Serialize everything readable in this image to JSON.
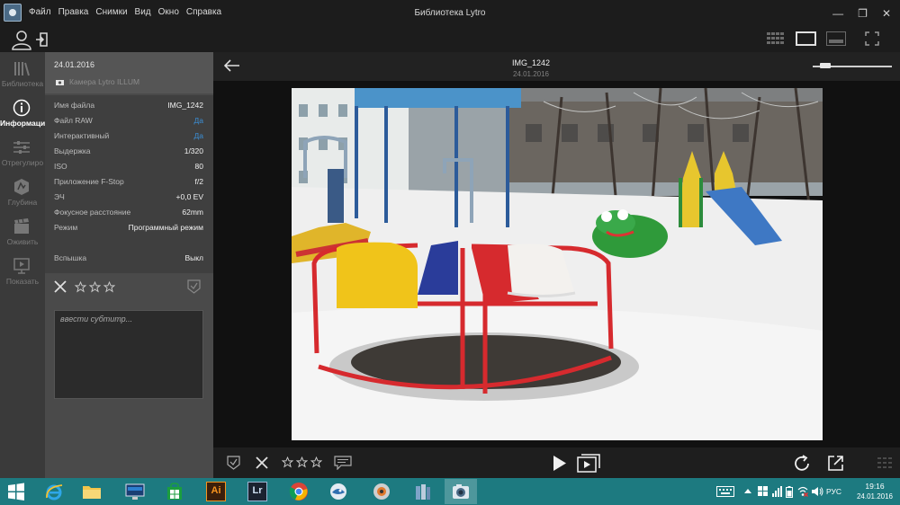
{
  "window": {
    "title": "Библиотека Lytro",
    "controls": {
      "minimize": "—",
      "restore": "❐",
      "close": "✕"
    }
  },
  "menu": [
    "Файл",
    "Правка",
    "Снимки",
    "Вид",
    "Окно",
    "Справка"
  ],
  "leftnav": [
    {
      "icon": "library-icon",
      "label": "Библиотека",
      "active": false
    },
    {
      "icon": "info-icon",
      "label": "Информаци",
      "active": true
    },
    {
      "icon": "adjust-sliders-icon",
      "label": "Отрегулиро",
      "active": false
    },
    {
      "icon": "depth-icon",
      "label": "Глубина",
      "active": false
    },
    {
      "icon": "animate-icon",
      "label": "Оживить",
      "active": false
    },
    {
      "icon": "present-icon",
      "label": "Показать",
      "active": false
    }
  ],
  "info": {
    "date": "24.01.2016",
    "camera": "Камера Lytro ILLUM",
    "properties": [
      {
        "label": "Имя файла",
        "value": "IMG_1242",
        "link": false
      },
      {
        "label": "Файл RAW",
        "value": "Да",
        "link": true
      },
      {
        "label": "Интерактивный",
        "value": "Да",
        "link": true
      },
      {
        "label": "Выдержка",
        "value": "1/320",
        "link": false
      },
      {
        "label": "ISO",
        "value": "80",
        "link": false
      },
      {
        "label": "Приложение F-Stop",
        "value": "f/2",
        "link": false
      },
      {
        "label": "ЭЧ",
        "value": "+0,0 EV",
        "link": false
      },
      {
        "label": "Фокусное расстояние",
        "value": "62mm",
        "link": false
      },
      {
        "label": "Режим",
        "value": "Программный режим",
        "link": false
      },
      {
        "label": "Вспышка",
        "value": "Выкл",
        "link": false
      }
    ],
    "rating": 0,
    "caption_placeholder": "ввести субтитр..."
  },
  "viewer": {
    "image_name": "IMG_1242",
    "image_date": "24.01.2016",
    "zoom_level": 0.1
  },
  "taskbar": {
    "apps": [
      "start",
      "internet-explorer",
      "file-explorer",
      "lenovo-app",
      "windows-store",
      "adobe-illustrator",
      "lightroom",
      "chrome",
      "mail-app",
      "camera-app",
      "archive-app",
      "lytro-library"
    ],
    "illustrator_label": "Ai",
    "lightroom_label": "Lr",
    "language": "РУС",
    "time": "19:16",
    "date": "24.01.2016"
  },
  "colors": {
    "accent_link": "#3b8fd6",
    "taskbar": "#1d7a80",
    "panel": "#4a4a4a",
    "nav": "#3a3a3a"
  }
}
